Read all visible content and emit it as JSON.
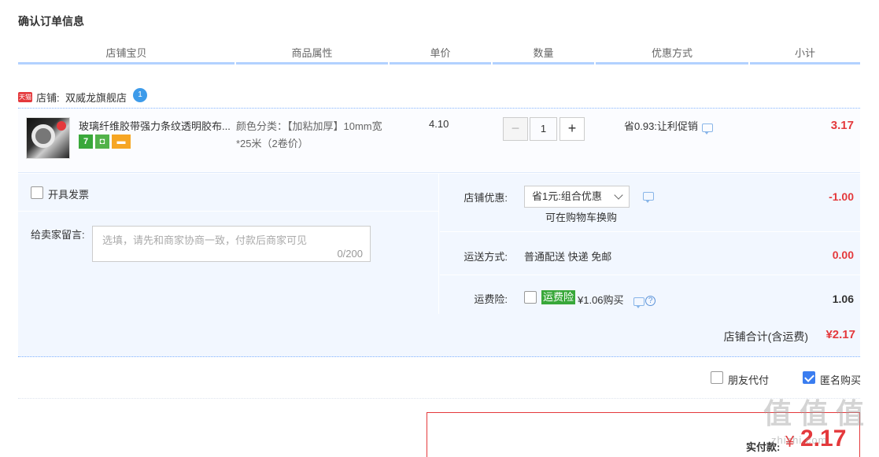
{
  "page": {
    "title": "确认订单信息"
  },
  "columns": [
    "店铺宝贝",
    "商品属性",
    "单价",
    "数量",
    "优惠方式",
    "小计"
  ],
  "shop": {
    "badge": "天猫",
    "prefix": "店铺:",
    "name": "双威龙旗舰店",
    "ww_icon": "chat-bubble-icon",
    "ww_glyph": "1"
  },
  "item": {
    "title": "玻璃纤维胶带强力条纹透明胶布...",
    "attributes": "颜色分类：【加粘加厚】10mm宽*25米（2卷价）",
    "price": "4.10",
    "quantity": "1",
    "minus": "−",
    "plus": "+",
    "promotion": "省0.93:让利促销",
    "subtotal": "3.17",
    "service_icons": [
      {
        "name": "seven-day-return-icon",
        "glyph": "7"
      },
      {
        "name": "guarantee-icon",
        "glyph": "◘"
      },
      {
        "name": "credit-card-icon",
        "glyph": "▬"
      }
    ]
  },
  "invoice": {
    "label": "开具发票"
  },
  "remark": {
    "label": "给卖家留言:",
    "placeholder": "选填，请先和商家协商一致，付款后商家可见",
    "counter": "0/200"
  },
  "shop_discount": {
    "label": "店铺优惠:",
    "selected": "省1元:组合优惠",
    "note": "可在购物车换购",
    "amount": "-1.00"
  },
  "shipping": {
    "label": "运送方式:",
    "value": "普通配送 快递 免邮",
    "amount": "0.00"
  },
  "insurance": {
    "label": "运费险:",
    "badge": "运费险",
    "text": "¥1.06购买",
    "help": "?",
    "amount": "1.06"
  },
  "shop_total": {
    "label": "店铺合计(含运费)",
    "value": "¥2.17"
  },
  "options": {
    "friend_pay": "朋友代付",
    "anonymous": "匿名购买",
    "anonymous_checked": true
  },
  "payment": {
    "label": "实付款:",
    "currency": "¥",
    "value": "2.17"
  },
  "watermark": {
    "chars": [
      "值",
      "值",
      "值"
    ],
    "domain": "zhizhi.com"
  },
  "colors": {
    "price_red": "#e4393c",
    "header_underline": "#b2d1ff",
    "panel_bg": "#f2f7ff",
    "checkbox_blue": "#3a7df0"
  }
}
